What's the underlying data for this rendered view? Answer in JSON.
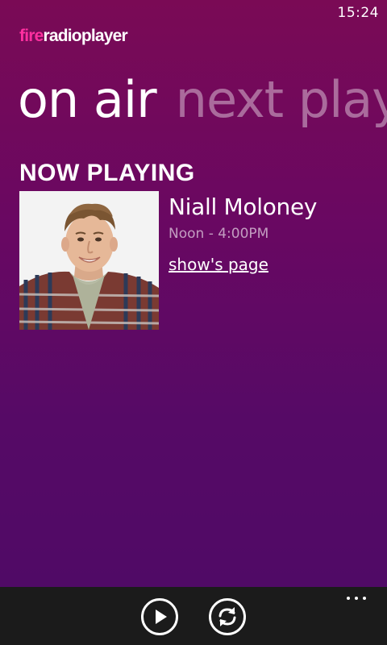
{
  "status_bar": {
    "time": "15:24"
  },
  "app": {
    "logo_fire": "fire",
    "logo_rest": "radioplayer",
    "brand_color": "#ff2fa0"
  },
  "pivot": {
    "items": [
      {
        "label": "on air",
        "active": true
      },
      {
        "label": "next playing",
        "active": false
      }
    ]
  },
  "now_playing": {
    "heading": "NOW PLAYING",
    "presenter": "Niall Moloney",
    "time": "Noon - 4:00PM",
    "link_label": "show's page"
  },
  "app_bar": {
    "buttons": [
      {
        "icon": "play-icon"
      },
      {
        "icon": "refresh-icon"
      }
    ],
    "more_icon": "more-icon"
  },
  "colors": {
    "background_top": "#7a0a55",
    "background_bottom": "#4e0a66",
    "app_bar": "#1b1b1b"
  }
}
